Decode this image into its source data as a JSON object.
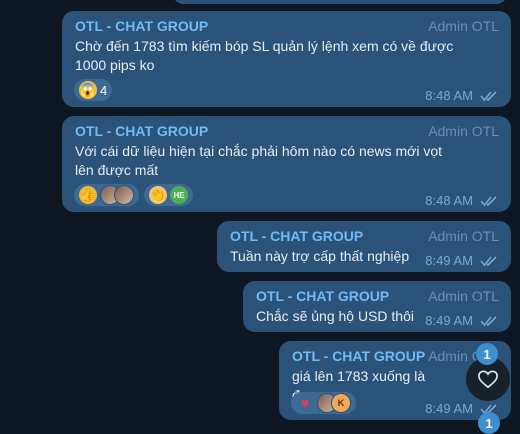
{
  "colors": {
    "background": "#0e1621",
    "bubble": "#2b5278",
    "sender": "#71baf5",
    "admin_label": "#6d8fb0",
    "time": "#7da8d3",
    "badge": "#3e8ed0"
  },
  "messages": [
    {
      "sender": "OTL - CHAT GROUP",
      "role": "Admin OTL",
      "text": "Chờ đến 1783 tìm kiếm bóp SL quản lý lệnh xem có về được 1000 pips ko",
      "time": "8:48 AM",
      "reactions": [
        {
          "icon": "screaming-face-emoji",
          "glyph": "😱",
          "count": "4"
        }
      ]
    },
    {
      "sender": "OTL - CHAT GROUP",
      "role": "Admin OTL",
      "text": "Với cái dữ liệu hiện tại chắc phải hôm nào có news mới vọt lên được mất",
      "time": "8:48 AM",
      "reactions": [
        {
          "icon": "thumbs-up-emoji",
          "glyph": "👍"
        },
        {
          "icon": "clapping-hands-emoji",
          "glyph": "👏",
          "initials": "HE"
        }
      ]
    },
    {
      "sender": "OTL - CHAT GROUP",
      "role": "Admin OTL",
      "text": "Tuần này trợ cấp thất nghiệp",
      "time": "8:49 AM"
    },
    {
      "sender": "OTL - CHAT GROUP",
      "role": "Admin OTL",
      "text": "Chắc sẽ ủng hộ USD thôi",
      "time": "8:49 AM"
    },
    {
      "sender": "OTL - CHAT GROUP",
      "role": "Admin OTL",
      "text": "giá lên 1783 xuống là đẹp",
      "time": "8:49 AM",
      "reactions": [
        {
          "icon": "red-heart-emoji",
          "glyph": "♥",
          "initials": "K"
        }
      ]
    }
  ],
  "floating": {
    "reaction_badge_count": "1",
    "scroll_badge_count": "1",
    "heart_icon": "heart-outline-icon"
  }
}
